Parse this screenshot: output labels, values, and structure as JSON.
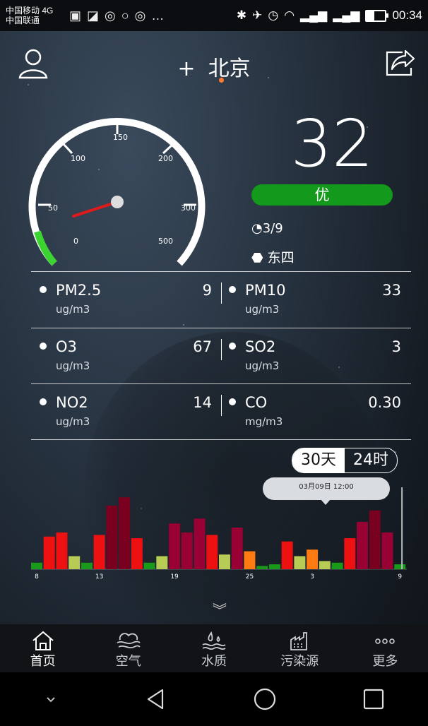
{
  "status_bar": {
    "carrier1": "中国移动 4G",
    "carrier2": "中国联通",
    "time": "00:34"
  },
  "header": {
    "add_symbol": "+",
    "city": "北京"
  },
  "aqi": {
    "value": "32",
    "level": "优",
    "level_color": "#139a1c",
    "date": "3/9",
    "station": "东四",
    "gauge_ticks": [
      "0",
      "50",
      "100",
      "150",
      "200",
      "300",
      "500"
    ]
  },
  "pollutants": [
    {
      "name": "PM2.5",
      "value": "9",
      "unit": "ug/m3"
    },
    {
      "name": "PM10",
      "value": "33",
      "unit": "ug/m3"
    },
    {
      "name": "O3",
      "value": "67",
      "unit": "ug/m3"
    },
    {
      "name": "SO2",
      "value": "3",
      "unit": "ug/m3"
    },
    {
      "name": "NO2",
      "value": "14",
      "unit": "ug/m3"
    },
    {
      "name": "CO",
      "value": "0.30",
      "unit": "mg/m3"
    }
  ],
  "tabs": {
    "days": "30天",
    "hours": "24时",
    "active": "days"
  },
  "tooltip": "03月09日 12:00",
  "chart_data": {
    "type": "bar",
    "x_tick_labels": [
      "8",
      "13",
      "19",
      "25",
      "3",
      "9"
    ],
    "colors": {
      "good": "#1a9a1a",
      "moderate": "#b8cc55",
      "unhealthy_sensitive": "#ff7a10",
      "unhealthy": "#ee1111",
      "very_unhealthy": "#990033",
      "hazardous": "#7a0020"
    },
    "values": [
      {
        "v": 8,
        "c": "good"
      },
      {
        "v": 40,
        "c": "unhealthy"
      },
      {
        "v": 45,
        "c": "unhealthy"
      },
      {
        "v": 16,
        "c": "moderate"
      },
      {
        "v": 8,
        "c": "good"
      },
      {
        "v": 42,
        "c": "unhealthy"
      },
      {
        "v": 78,
        "c": "hazardous"
      },
      {
        "v": 88,
        "c": "hazardous"
      },
      {
        "v": 38,
        "c": "unhealthy"
      },
      {
        "v": 8,
        "c": "good"
      },
      {
        "v": 16,
        "c": "moderate"
      },
      {
        "v": 56,
        "c": "very_unhealthy"
      },
      {
        "v": 45,
        "c": "very_unhealthy"
      },
      {
        "v": 62,
        "c": "very_unhealthy"
      },
      {
        "v": 42,
        "c": "unhealthy"
      },
      {
        "v": 18,
        "c": "moderate"
      },
      {
        "v": 51,
        "c": "very_unhealthy"
      },
      {
        "v": 22,
        "c": "unhealthy_sensitive"
      },
      {
        "v": 4,
        "c": "good"
      },
      {
        "v": 6,
        "c": "good"
      },
      {
        "v": 34,
        "c": "unhealthy"
      },
      {
        "v": 16,
        "c": "moderate"
      },
      {
        "v": 24,
        "c": "unhealthy_sensitive"
      },
      {
        "v": 10,
        "c": "moderate"
      },
      {
        "v": 8,
        "c": "good"
      },
      {
        "v": 38,
        "c": "unhealthy"
      },
      {
        "v": 58,
        "c": "very_unhealthy"
      },
      {
        "v": 72,
        "c": "hazardous"
      },
      {
        "v": 45,
        "c": "very_unhealthy"
      },
      {
        "v": 6,
        "c": "good"
      }
    ]
  },
  "nav": [
    {
      "label": "首页",
      "icon": "home-icon"
    },
    {
      "label": "空气",
      "icon": "air-icon"
    },
    {
      "label": "水质",
      "icon": "water-icon"
    },
    {
      "label": "污染源",
      "icon": "factory-icon"
    },
    {
      "label": "更多",
      "icon": "more-icon"
    }
  ]
}
